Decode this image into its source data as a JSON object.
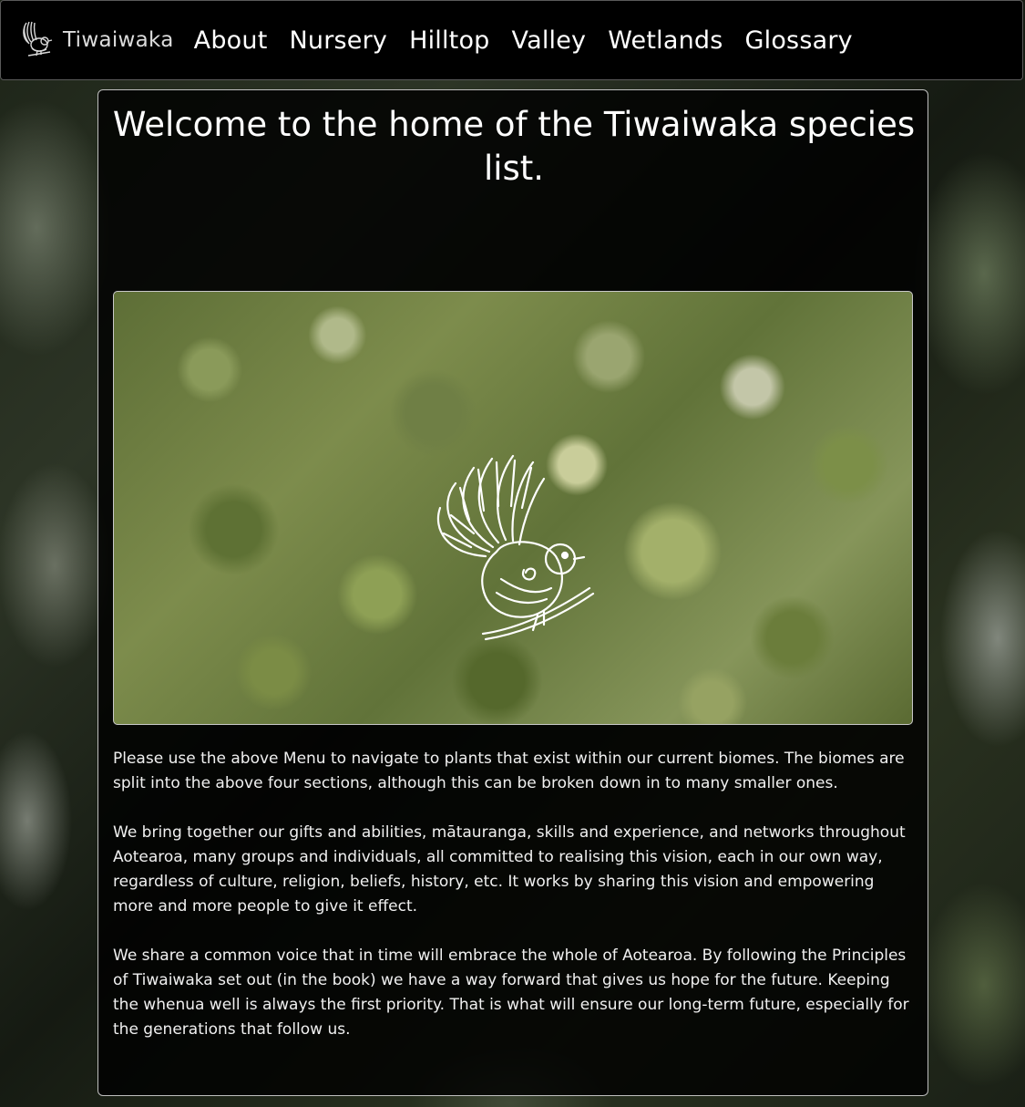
{
  "nav": {
    "brand_name": "Tiwaiwaka",
    "brand_icon": "fantail-bird-icon",
    "links": [
      {
        "label": "About"
      },
      {
        "label": "Nursery"
      },
      {
        "label": "Hilltop"
      },
      {
        "label": "Valley"
      },
      {
        "label": "Wetlands"
      },
      {
        "label": "Glossary"
      }
    ]
  },
  "main": {
    "title": "Welcome to the home of the Tiwaiwaka species list.",
    "hero_icon": "fantail-bird-icon",
    "paragraphs": [
      "Please use the above Menu to navigate to plants that exist within our current biomes. The biomes are split into the above four sections, although this can be broken down in to many smaller ones.",
      "We bring together our gifts and abilities, mātauranga, skills and experience, and networks throughout Aotearoa, many groups and individuals, all committed to realising this vision, each in our own way, regardless of culture, religion, beliefs, history, etc. It works by sharing this vision and empowering more and more people to give it effect.",
      "We share a common voice that in time will embrace the whole of Aotearoa. By following the Principles of Tiwaiwaka set out (in the book) we have a way forward that gives us hope for the future. Keeping the whenua well is always the first priority. That is what will ensure our long-term future, especially for the generations that follow us."
    ]
  },
  "colors": {
    "nav_background": "#000000",
    "card_background": "#000000",
    "text": "#ffffff"
  }
}
